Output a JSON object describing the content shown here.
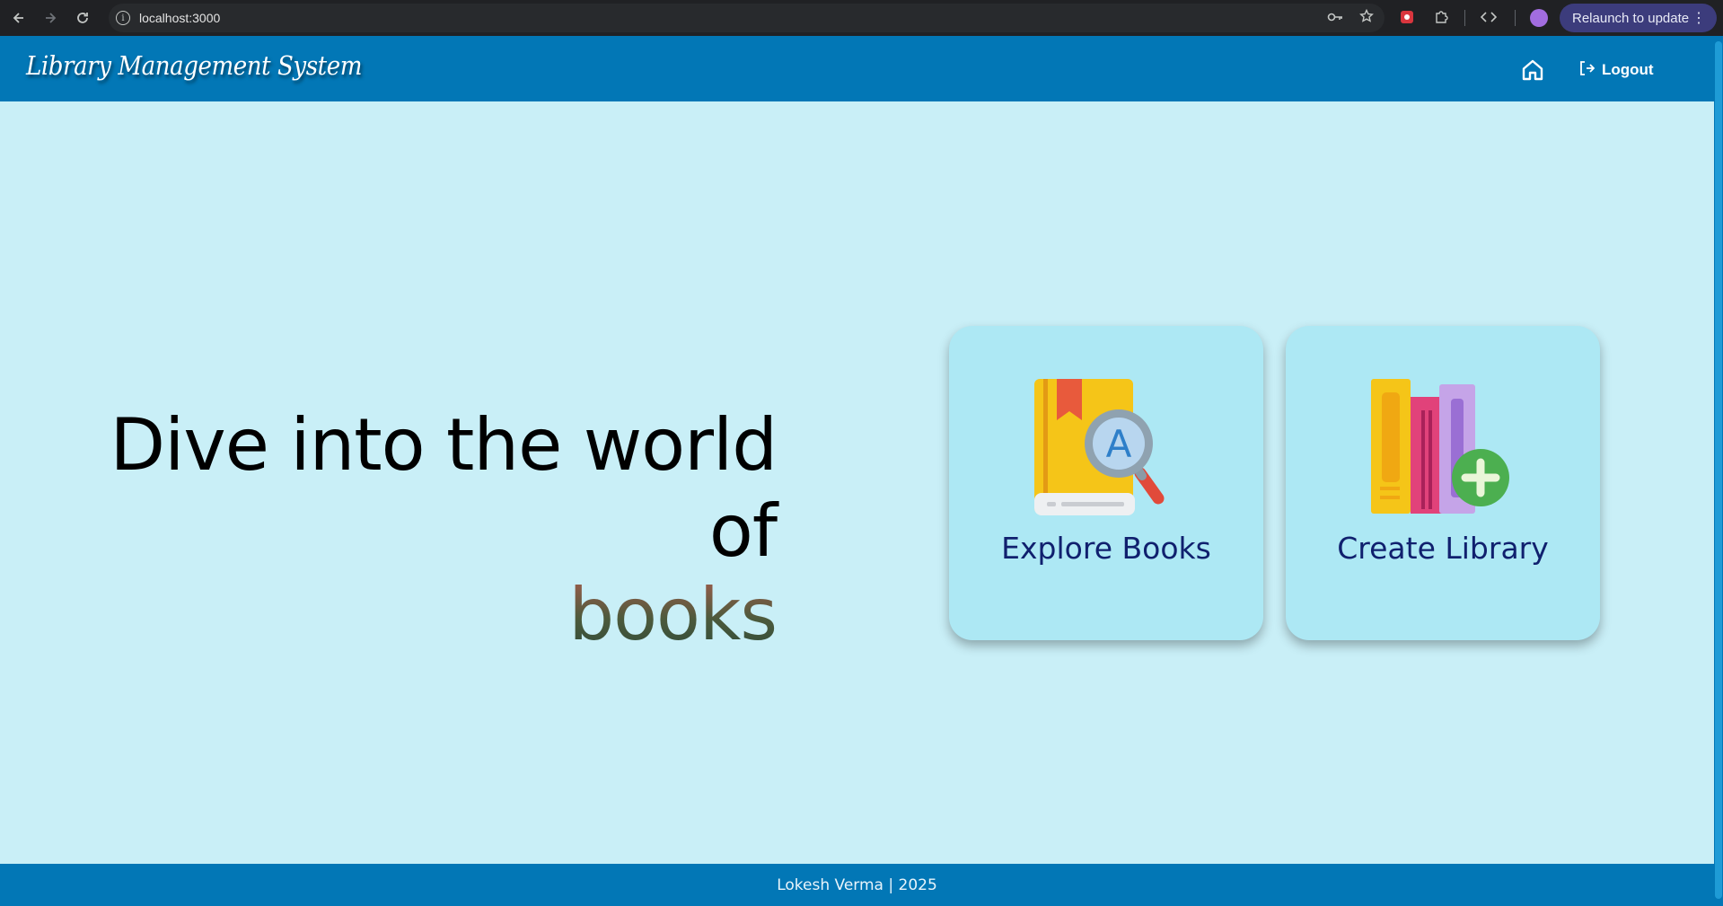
{
  "browser": {
    "url": "localhost:3000",
    "relaunch_label": "Relaunch to update",
    "icons": [
      "back-icon",
      "forward-icon",
      "reload-icon",
      "site-info-icon",
      "password-key-icon",
      "bookmark-star-icon",
      "extension-icon",
      "puzzle-icon",
      "devtools-icon",
      "profile-avatar",
      "menu-dots-icon"
    ]
  },
  "header": {
    "brand": "Library Management System",
    "logout_label": "Logout",
    "background": "#0277b6"
  },
  "hero": {
    "line1": "Dive into the world of",
    "line2": "books"
  },
  "cards": {
    "explore": {
      "label": "Explore Books",
      "icon": "book-search-icon"
    },
    "create": {
      "label": "Create Library",
      "icon": "books-add-icon"
    }
  },
  "footer": {
    "text": "Lokesh Verma | 2025"
  },
  "colors": {
    "page_background": "#c9eff7",
    "card_background": "#ade8f4",
    "card_text": "#10206e"
  }
}
